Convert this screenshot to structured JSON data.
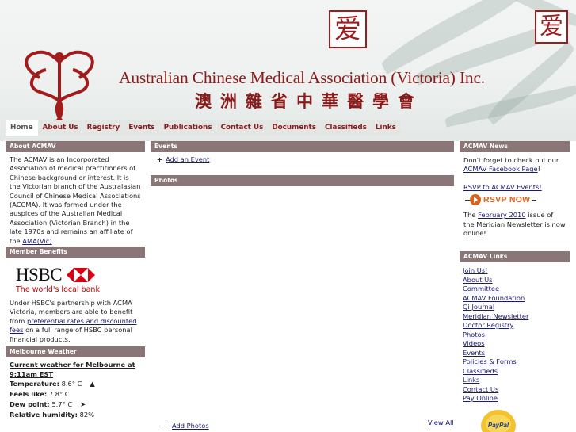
{
  "header": {
    "title_en": "Australian Chinese Medical Association (Victoria) Inc.",
    "title_zh": "澳洲雜省中華醫學會",
    "seal_char": "爱"
  },
  "nav": {
    "items": [
      "Home",
      "About Us",
      "Registry",
      "Events",
      "Publications",
      "Contact Us",
      "Documents",
      "Classifieds",
      "Links"
    ]
  },
  "about": {
    "heading": "About ACMAV",
    "body": "The ACMAV is an Incorporated Association of medical practitioners of Chinese background or interest. It is the Victorian branch of the Australasian Council of Chinese Medical Associations (ACCMA). It was formed under the auspices of the Australian Medical Association (Victorian Branch) in the late 1970s and remains an affiliate of the ",
    "link": "AMA(Vic)",
    "end": "."
  },
  "benefits": {
    "heading": "Member Benefits",
    "logo_word": "HSBC",
    "tagline": "The world's local bank",
    "text_before": "Under HSBC's partnership with ACMA Victoria, members are able to benefit from ",
    "link": "preferential rates and discounted fees",
    "text_after": " on a full range of HSBC personal financial products."
  },
  "weather": {
    "heading": "Melbourne Weather",
    "title": "Current weather for Melbourne at 9:11am EST",
    "rows": [
      {
        "label": "Temperature:",
        "value": "8.6° C",
        "arrow": "▲"
      },
      {
        "label": "Feels like:",
        "value": "7.8° C",
        "arrow": ""
      },
      {
        "label": "Dew point:",
        "value": "5.7° C",
        "arrow": "➤"
      },
      {
        "label": "Relative humidity:",
        "value": "82%",
        "arrow": ""
      }
    ]
  },
  "events": {
    "heading": "Events",
    "add_label": "Add an Event"
  },
  "photos": {
    "heading": "Photos",
    "add_label": "Add Photos",
    "view_all": "View All"
  },
  "news": {
    "heading": "ACMAV News",
    "line1": "Don't forget to check out our ",
    "fb_link": "ACMAV Facebook Page",
    "line1_end": "!",
    "rsvp_link": "RSVP to ACMAV Events!",
    "rsvp_button": "RSVP NOW",
    "line3_pre": "The ",
    "newsletter_link": "February 2010",
    "line3_post": " issue of the Meridian Newsletter is now online!"
  },
  "links": {
    "heading": "ACMAV Links",
    "items": [
      "Join Us!",
      "About Us",
      "Committee",
      "ACMAV Foundation",
      "Qi Journal",
      "Meridian Newsletter",
      "Doctor Registry",
      "Photos",
      "Videos",
      "Events",
      "Policies & Forms",
      "Classifieds",
      "Links",
      "Contact Us",
      "Pay Online"
    ]
  },
  "paypal": {
    "label": "PayPal"
  },
  "colors": {
    "brand": "#8b1a1a",
    "bar": "#8a7676",
    "hsbc_red": "#db0011",
    "rsvp": "#d9631e"
  }
}
